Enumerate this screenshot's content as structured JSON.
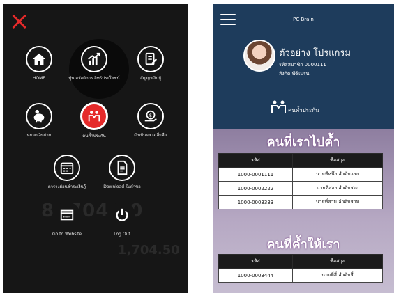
{
  "left_menu": {
    "items": [
      {
        "label": "HOME",
        "icon": "home-icon"
      },
      {
        "label": "หุ้น สวัสดิการ สิทธิประโยชน์",
        "icon": "stock-chart-icon"
      },
      {
        "label": "สัญญาเงินกู้",
        "icon": "loan-contract-icon"
      },
      {
        "label": "หมวดเงินฝาก",
        "icon": "piggy-bank-icon"
      },
      {
        "label": "คนค้ำประกัน",
        "icon": "guarantor-icon"
      },
      {
        "label": "เงินปันผล เฉลี่ยคืน",
        "icon": "dividend-icon"
      },
      {
        "label": "ตารางผ่อนชำระเงินกู้",
        "icon": "calendar-icon"
      },
      {
        "label": "Download ใบคำขอ",
        "icon": "document-icon"
      },
      {
        "label": "Go to Website",
        "icon": "website-icon"
      },
      {
        "label": "Log Out",
        "icon": "power-icon"
      }
    ],
    "background_values": [
      "1,704.50"
    ]
  },
  "app": {
    "title": "PC Brain",
    "user": {
      "name": "ตัวอย่าง โปรแกรม",
      "member_id": "รหัสสมาชิก 0000111",
      "department": "สังกัด พีซีเบรน"
    },
    "guarantee_label": "คนค้ำประกัน",
    "section1": {
      "title": "คนที่เราไปค้ำ",
      "headers": [
        "รหัส",
        "ชื่อสกุล"
      ],
      "rows": [
        {
          "id": "1000-0001111",
          "name": "นายที่หนึ่ง ลำดับแรก"
        },
        {
          "id": "1000-0002222",
          "name": "นายที่สอง ลำดับสอง"
        },
        {
          "id": "1000-0003333",
          "name": "นายที่สาม ลำดับสาม"
        }
      ]
    },
    "section2": {
      "title": "คนที่ค้ำให้เรา",
      "headers": [
        "รหัส",
        "ชื่อสกุล"
      ],
      "rows": [
        {
          "id": "1000-0003444",
          "name": "นายที่สี่ ลำดับสี่"
        }
      ]
    },
    "colors": {
      "header": "#1e3c5c",
      "accent": "#e52a2a",
      "purple": "#8e7ea0"
    }
  }
}
